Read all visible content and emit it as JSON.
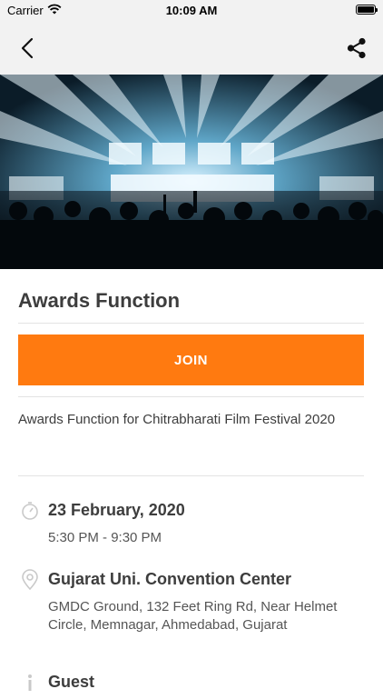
{
  "status_bar": {
    "carrier": "Carrier",
    "time": "10:09 AM"
  },
  "icons": {
    "back": "chevron-left-icon",
    "share": "share-icon",
    "wifi": "wifi-icon",
    "battery": "battery-icon",
    "clock": "clock-icon",
    "location": "location-pin-icon",
    "info": "info-icon"
  },
  "event": {
    "title": "Awards Function",
    "join_label": "JOIN",
    "description": "Awards Function for Chitrabharati Film Festival 2020",
    "date": "23 February, 2020",
    "time_range": "5:30 PM - 9:30 PM",
    "venue": "Gujarat Uni. Convention Center",
    "address": "GMDC Ground, 132 Feet Ring Rd, Near Helmet Circle, Memnagar, Ahmedabad, Gujarat",
    "next_section_label": "Guest"
  },
  "colors": {
    "accent": "#ff7a10",
    "nav_bg": "#f2f2f2"
  }
}
